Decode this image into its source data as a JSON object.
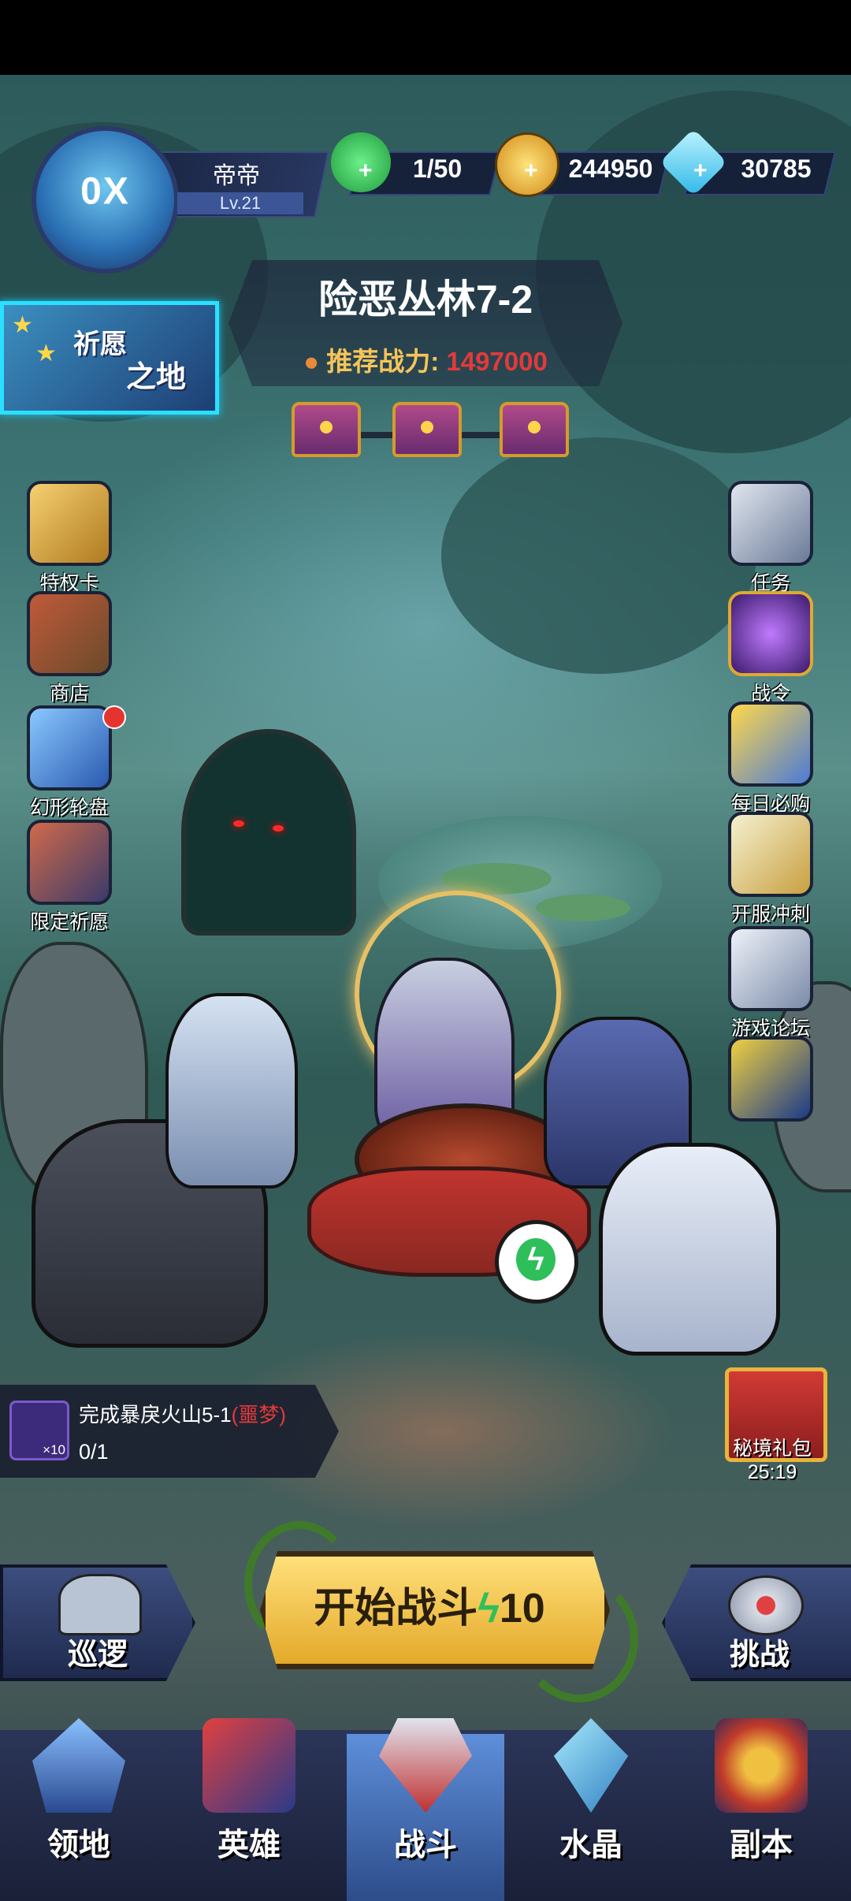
{
  "player": {
    "name": "帝帝",
    "level": "Lv.21"
  },
  "resources": {
    "energy": "1/50",
    "gold": "244950",
    "gems": "30785"
  },
  "stage": {
    "title": "险恶丛林7-2",
    "power_label": "推荐战力:",
    "power_value": "1497000"
  },
  "wish_banner": {
    "line1": "祈愿",
    "line2": "之地"
  },
  "left_menu": [
    {
      "label": "特权卡",
      "icon": "privilege-card-icon",
      "color": "#d8a23a"
    },
    {
      "label": "商店",
      "icon": "shop-icon",
      "color": "#8a6a3a"
    },
    {
      "label": "幻形轮盘",
      "icon": "wheel-icon",
      "color": "#4a7ad8"
    },
    {
      "label": "限定祈愿",
      "icon": "limited-wish-icon",
      "color": "#7a4a6a"
    }
  ],
  "right_menu": [
    {
      "label": "任务",
      "icon": "scroll-icon",
      "color": "#7a8aa8"
    },
    {
      "label": "战令",
      "icon": "battle-pass-icon",
      "color": "#5a2a8a"
    },
    {
      "label": "每日必购",
      "icon": "daily-deal-icon",
      "color": "#e0a030"
    },
    {
      "label": "开服冲刺",
      "icon": "swords-icon",
      "color": "#d8c060"
    },
    {
      "label": "游戏论坛",
      "icon": "forum-icon",
      "color": "#8a98b0"
    },
    {
      "label": "",
      "icon": "lightning-box-icon",
      "color": "#2a5aa8"
    }
  ],
  "quest": {
    "gem_count": "×10",
    "prefix": "完成暴戾火山5-1",
    "tag": "(噩梦)",
    "progress": "0/1"
  },
  "gift": {
    "label": "秘境礼包",
    "timer": "25:19"
  },
  "actions": {
    "patrol": "巡逻",
    "start": "开始战斗",
    "start_cost": "10",
    "challenge": "挑战"
  },
  "nav": [
    {
      "label": "领地",
      "icon": "territory-icon"
    },
    {
      "label": "英雄",
      "icon": "hero-icon"
    },
    {
      "label": "战斗",
      "icon": "battle-icon"
    },
    {
      "label": "水晶",
      "icon": "crystal-icon"
    },
    {
      "label": "副本",
      "icon": "dungeon-icon"
    }
  ]
}
